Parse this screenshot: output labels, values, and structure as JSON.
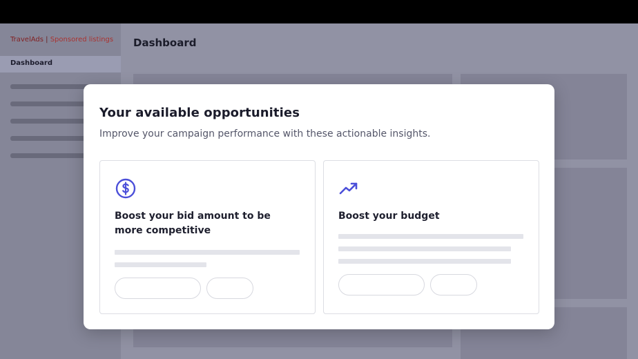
{
  "app": {
    "brand": "TravelAds",
    "brand_separator": "|",
    "brand_sub": "Sponsored listings",
    "active_nav": "Dashboard",
    "page_title": "Dashboard"
  },
  "modal": {
    "title": "Your available opportunities",
    "subtitle": "Improve your campaign performance with these actionable insights.",
    "cards": [
      {
        "icon": "dollar-circle-icon",
        "title": "Boost your bid amount to be more competitive"
      },
      {
        "icon": "trending-up-icon",
        "title": "Boost your budget"
      }
    ]
  },
  "colors": {
    "accent": "#4b4fd9",
    "brand": "#b5342f",
    "overlay": "#9b9cad"
  }
}
